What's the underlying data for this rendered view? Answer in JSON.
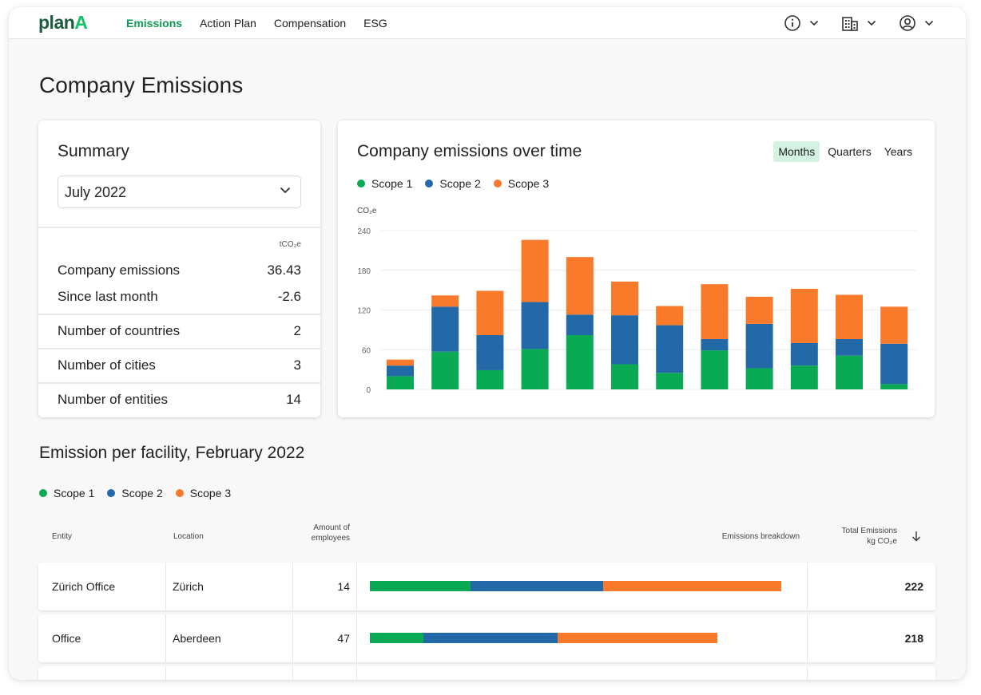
{
  "app": {
    "logo_main": "plan",
    "logo_accent": "A"
  },
  "nav": [
    {
      "label": "Emissions",
      "active": true
    },
    {
      "label": "Action Plan",
      "active": false
    },
    {
      "label": "Compensation",
      "active": false
    },
    {
      "label": "ESG",
      "active": false
    }
  ],
  "topbar_icons": [
    "info-icon",
    "building-icon",
    "user-icon"
  ],
  "page_title": "Company Emissions",
  "summary": {
    "title": "Summary",
    "period": "July 2022",
    "unit": "tCO₂e",
    "rows": [
      {
        "label": "Company emissions",
        "value": "36.43"
      },
      {
        "label": "Since last month",
        "value": "-2.6"
      },
      {
        "label": "Number of countries",
        "value": "2"
      },
      {
        "label": "Number of cities",
        "value": "3"
      },
      {
        "label": "Number of entities",
        "value": "14"
      }
    ]
  },
  "chart_card": {
    "title": "Company emissions over time",
    "toggles": [
      "Months",
      "Quarters",
      "Years"
    ],
    "active_toggle": "Months",
    "legend": [
      "Scope 1",
      "Scope 2",
      "Scope 3"
    ]
  },
  "colors": {
    "scope1": "#0aaa54",
    "scope2": "#2469a7",
    "scope3": "#f97a2b",
    "brand": "#14c169"
  },
  "chart_data": {
    "type": "bar",
    "stacked": true,
    "ylabel": "CO₂e",
    "ylim": [
      0,
      240
    ],
    "yticks": [
      0,
      60,
      120,
      180,
      240
    ],
    "grid": true,
    "series": [
      {
        "name": "Scope 1",
        "values": [
          20,
          57,
          29,
          61,
          82,
          38,
          25,
          59,
          32,
          36,
          51,
          8
        ]
      },
      {
        "name": "Scope 2",
        "values": [
          16,
          68,
          53,
          71,
          31,
          74,
          72,
          17,
          67,
          34,
          25,
          61
        ]
      },
      {
        "name": "Scope 3",
        "values": [
          9,
          17,
          67,
          94,
          87,
          51,
          29,
          83,
          41,
          82,
          67,
          56
        ]
      }
    ]
  },
  "facility": {
    "title": "Emission per facility, February 2022",
    "legend": [
      "Scope 1",
      "Scope 2",
      "Scope 3"
    ],
    "headers": {
      "entity": "Entity",
      "location": "Location",
      "employees_line1": "Amount of",
      "employees_line2": "employees",
      "breakdown": "Emissions breakdown",
      "total_line1": "Total Emissions",
      "total_line2": "kg CO₂e"
    },
    "rows": [
      {
        "entity": "Zürich Office",
        "location": "Zürich",
        "employees": "14",
        "breakdown": [
          0.245,
          0.322,
          0.433
        ],
        "total": "222"
      },
      {
        "entity": "Office",
        "location": "Aberdeen",
        "employees": "47",
        "breakdown": [
          0.153,
          0.388,
          0.459
        ],
        "total": "218"
      }
    ]
  }
}
